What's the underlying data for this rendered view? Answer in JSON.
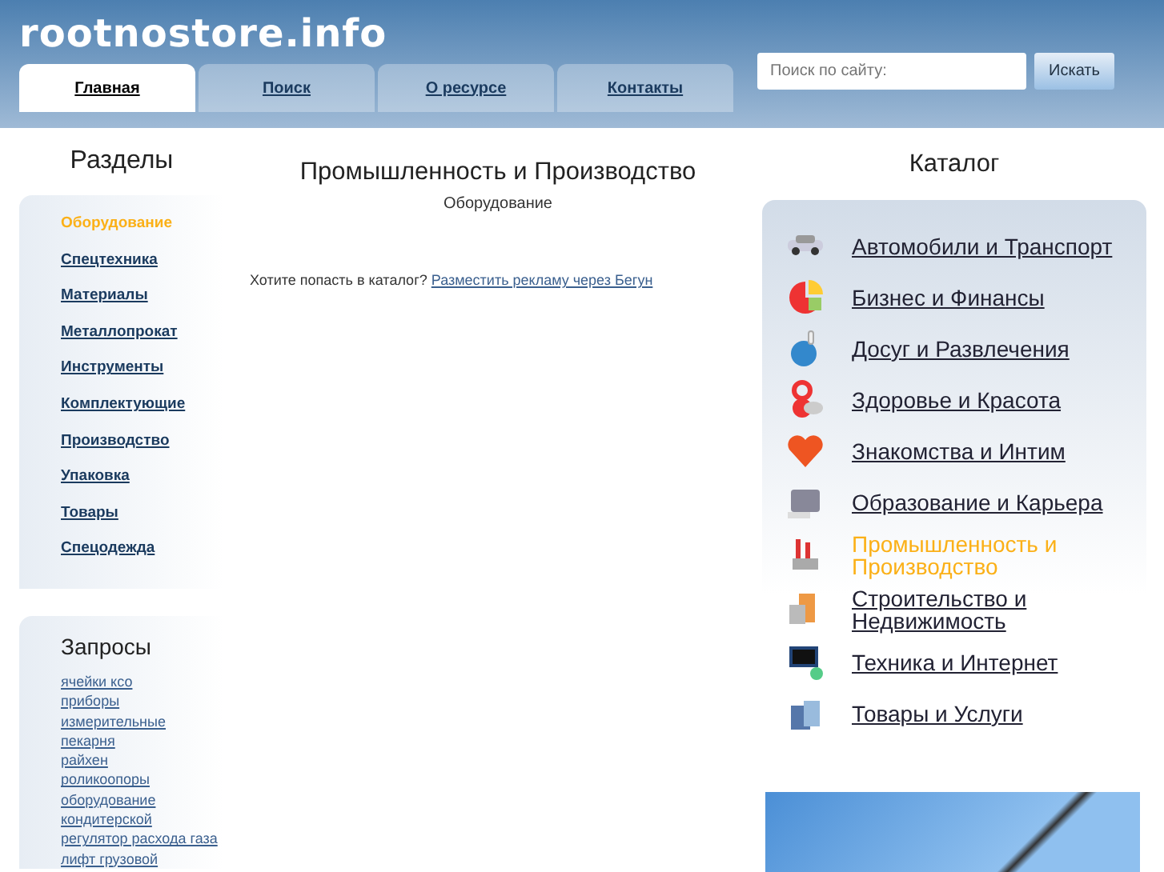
{
  "site_title": "rootnostore.info",
  "tabs": [
    {
      "label": "Главная",
      "selected": true
    },
    {
      "label": "Поиск",
      "selected": false
    },
    {
      "label": "О ресурсе",
      "selected": false
    },
    {
      "label": "Контакты",
      "selected": false
    }
  ],
  "search": {
    "placeholder": "Поиск по сайту:",
    "button": "Искать"
  },
  "sections": {
    "title": "Разделы",
    "items": [
      {
        "label": "Оборудование",
        "selected": true
      },
      {
        "label": "Спецтехника",
        "selected": false
      },
      {
        "label": "Материалы",
        "selected": false
      },
      {
        "label": "Металлопрокат",
        "selected": false
      },
      {
        "label": "Инструменты",
        "selected": false
      },
      {
        "label": "Комплектующие",
        "selected": false
      },
      {
        "label": "Производство",
        "selected": false
      },
      {
        "label": "Упаковка",
        "selected": false
      },
      {
        "label": "Товары",
        "selected": false
      },
      {
        "label": "Спецодежда",
        "selected": false
      }
    ]
  },
  "queries": {
    "title": "Запросы",
    "items": [
      "ячейки ксо",
      "приборы измерительные",
      "пекарня",
      "райхен",
      "роликоопоры",
      "оборудование кондитерской",
      "регулятор расхода газа",
      "лифт грузовой"
    ]
  },
  "main": {
    "heading": "Промышленность и Производство",
    "subheading": "Оборудование",
    "prompt": "Хотите попасть в каталог?",
    "link": "Разместить рекламу через Бегун"
  },
  "catalog": {
    "title": "Каталог",
    "items": [
      {
        "label": "Автомобили и Транспорт",
        "kind": "car",
        "selected": false
      },
      {
        "label": "Бизнес и Финансы",
        "kind": "pie",
        "selected": false
      },
      {
        "label": "Досуг и Развлечения",
        "kind": "bowling",
        "selected": false
      },
      {
        "label": "Здоровье и Красота",
        "kind": "health",
        "selected": false
      },
      {
        "label": "Знакомства и Интим",
        "kind": "heart",
        "selected": false
      },
      {
        "label": "Образование и Карьера",
        "kind": "case",
        "selected": false
      },
      {
        "label": "Промышленность и Производство",
        "kind": "factory",
        "selected": true
      },
      {
        "label": "Строительство и Недвижимость",
        "kind": "building",
        "selected": false
      },
      {
        "label": "Техника и Интернет",
        "kind": "monitor",
        "selected": false
      },
      {
        "label": "Товары и Услуги",
        "kind": "bags",
        "selected": false
      }
    ]
  }
}
